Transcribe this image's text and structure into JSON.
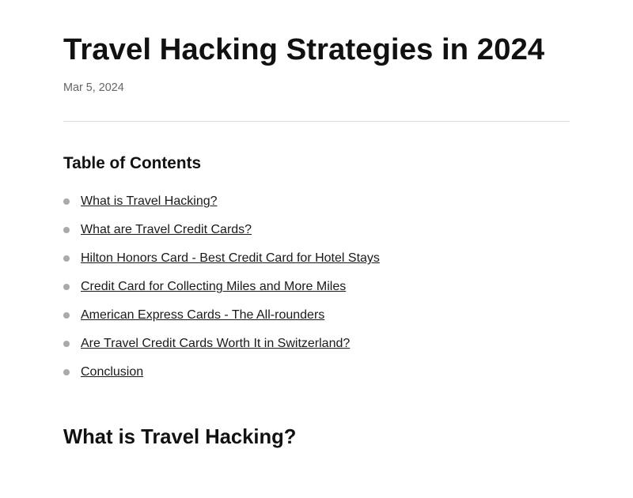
{
  "article": {
    "title": "Travel Hacking Strategies in 2024",
    "date": "Mar 5, 2024"
  },
  "toc": {
    "heading": "Table of Contents",
    "items": [
      {
        "label": "What is Travel Hacking?",
        "href": "#what-is-travel-hacking"
      },
      {
        "label": "What are Travel Credit Cards?",
        "href": "#what-are-travel-credit-cards"
      },
      {
        "label": "Hilton Honors Card - Best Credit Card for Hotel Stays",
        "href": "#hilton-honors-card"
      },
      {
        "label": "Credit Card for Collecting Miles and More Miles",
        "href": "#collecting-miles"
      },
      {
        "label": "American Express Cards - The All-rounders",
        "href": "#american-express-cards"
      },
      {
        "label": "Are Travel Credit Cards Worth It in Switzerland?",
        "href": "#worth-it-in-switzerland"
      },
      {
        "label": "Conclusion",
        "href": "#conclusion"
      }
    ]
  },
  "first_section": {
    "heading": "What is Travel Hacking?"
  }
}
